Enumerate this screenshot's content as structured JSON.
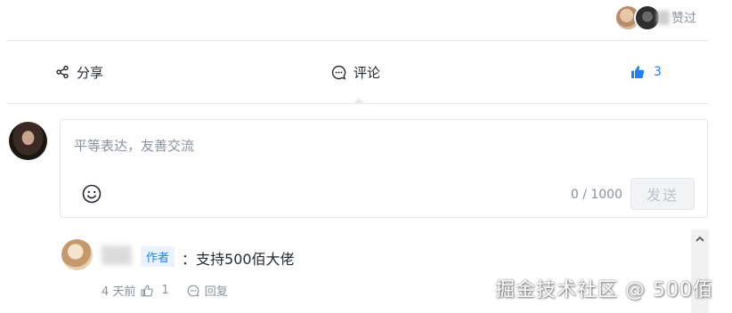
{
  "liked": {
    "text": "赞过"
  },
  "actions": {
    "share_label": "分享",
    "comment_label": "评论",
    "like_count": "3"
  },
  "editor": {
    "placeholder": "平等表达，友善交流",
    "counter": "0 / 1000",
    "send_label": "发送"
  },
  "comment": {
    "author_badge": "作者",
    "text": "支持500佰大佬",
    "time": "4 天前",
    "like_count": "1",
    "reply_label": "回复"
  },
  "watermark": "掘金技术社区 @ 500佰",
  "colors": {
    "accent": "#1e80ff",
    "muted": "#8a919f",
    "border": "#e4e6eb"
  }
}
